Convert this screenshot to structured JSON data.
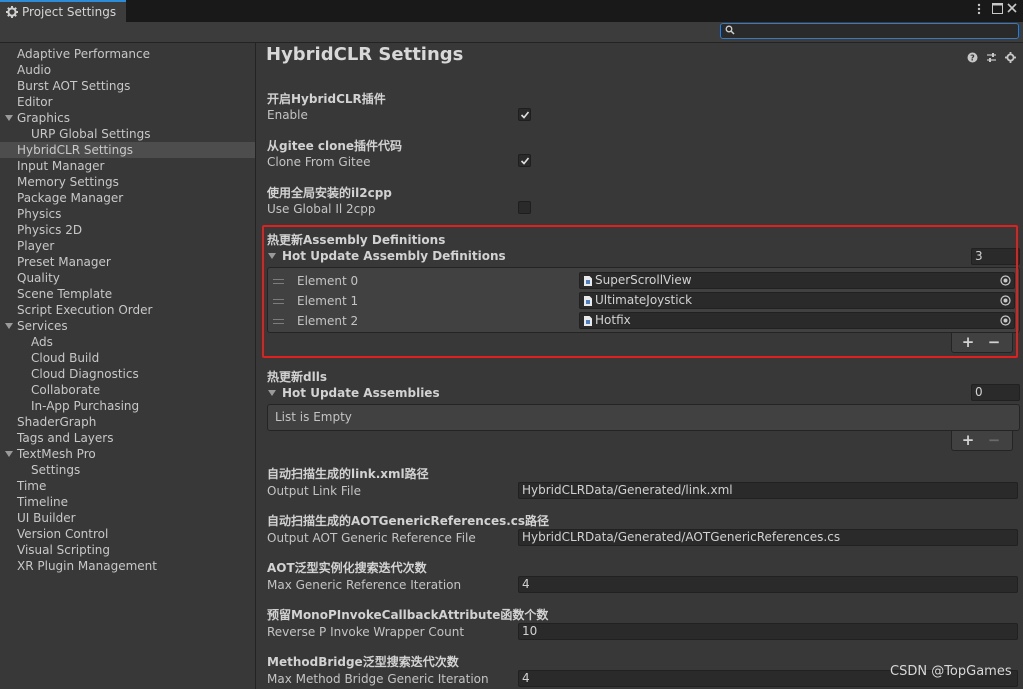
{
  "window": {
    "tab_title": "Project Settings",
    "tab_icon": "gear-icon"
  },
  "search": {
    "value": "",
    "placeholder": ""
  },
  "sidebar": {
    "items": [
      {
        "label": "Adaptive Performance",
        "indent": 0
      },
      {
        "label": "Audio",
        "indent": 0
      },
      {
        "label": "Burst AOT Settings",
        "indent": 0
      },
      {
        "label": "Editor",
        "indent": 0
      },
      {
        "label": "Graphics",
        "indent": 0,
        "expanded": true
      },
      {
        "label": "URP Global Settings",
        "indent": 1
      },
      {
        "label": "HybridCLR Settings",
        "indent": 0,
        "selected": true
      },
      {
        "label": "Input Manager",
        "indent": 0
      },
      {
        "label": "Memory Settings",
        "indent": 0
      },
      {
        "label": "Package Manager",
        "indent": 0
      },
      {
        "label": "Physics",
        "indent": 0
      },
      {
        "label": "Physics 2D",
        "indent": 0
      },
      {
        "label": "Player",
        "indent": 0
      },
      {
        "label": "Preset Manager",
        "indent": 0
      },
      {
        "label": "Quality",
        "indent": 0
      },
      {
        "label": "Scene Template",
        "indent": 0
      },
      {
        "label": "Script Execution Order",
        "indent": 0
      },
      {
        "label": "Services",
        "indent": 0,
        "expanded": true
      },
      {
        "label": "Ads",
        "indent": 1
      },
      {
        "label": "Cloud Build",
        "indent": 1
      },
      {
        "label": "Cloud Diagnostics",
        "indent": 1
      },
      {
        "label": "Collaborate",
        "indent": 1
      },
      {
        "label": "In-App Purchasing",
        "indent": 1
      },
      {
        "label": "ShaderGraph",
        "indent": 0
      },
      {
        "label": "Tags and Layers",
        "indent": 0
      },
      {
        "label": "TextMesh Pro",
        "indent": 0,
        "expanded": true
      },
      {
        "label": "Settings",
        "indent": 1
      },
      {
        "label": "Time",
        "indent": 0
      },
      {
        "label": "Timeline",
        "indent": 0
      },
      {
        "label": "UI Builder",
        "indent": 0
      },
      {
        "label": "Version Control",
        "indent": 0
      },
      {
        "label": "Visual Scripting",
        "indent": 0
      },
      {
        "label": "XR Plugin Management",
        "indent": 0
      }
    ]
  },
  "main": {
    "title": "HybridCLR Settings",
    "header_icons": [
      "help-icon",
      "sliders-icon",
      "gear-icon"
    ],
    "enable": {
      "section": "开启HybridCLR插件",
      "label": "Enable",
      "checked": true
    },
    "clone_from_gitee": {
      "section": "从gitee clone插件代码",
      "label": "Clone From Gitee",
      "checked": true
    },
    "use_global_il2cpp": {
      "section": "使用全局安装的il2cpp",
      "label": "Use Global Il 2cpp",
      "checked": false
    },
    "hot_update_asmdefs": {
      "section": "热更新Assembly Definitions",
      "foldout": "Hot Update Assembly Definitions",
      "size": "3",
      "elements": [
        {
          "label": "Element 0",
          "value": "SuperScrollView"
        },
        {
          "label": "Element 1",
          "value": "UltimateJoystick"
        },
        {
          "label": "Element 2",
          "value": "Hotfix"
        }
      ],
      "add_label": "+",
      "remove_label": "−"
    },
    "hot_update_dlls": {
      "section": "热更新dlls",
      "foldout": "Hot Update Assemblies",
      "size": "0",
      "empty_text": "List is Empty",
      "add_label": "+",
      "remove_label": "−"
    },
    "output_link_file": {
      "section": "自动扫描生成的link.xml路径",
      "label": "Output Link File",
      "value": "HybridCLRData/Generated/link.xml"
    },
    "output_aot_ref": {
      "section": "自动扫描生成的AOTGenericReferences.cs路径",
      "label": "Output AOT Generic Reference File",
      "value": "HybridCLRData/Generated/AOTGenericReferences.cs"
    },
    "max_generic_ref_iter": {
      "section": "AOT泛型实例化搜索迭代次数",
      "label": "Max Generic Reference Iteration",
      "value": "4"
    },
    "reverse_pinvoke": {
      "section": "预留MonoPInvokeCallbackAttribute函数个数",
      "label": "Reverse P Invoke Wrapper Count",
      "value": "10"
    },
    "max_method_bridge": {
      "section": "MethodBridge泛型搜索迭代次数",
      "label": "Max Method Bridge Generic Iteration",
      "value": "4"
    }
  },
  "watermark": "CSDN @TopGames",
  "colors": {
    "highlight_border": "#e0201f",
    "tab_accent": "#2d8cd8",
    "search_border": "#3a79bb",
    "selected_item_bg": "#4d4d4d"
  }
}
